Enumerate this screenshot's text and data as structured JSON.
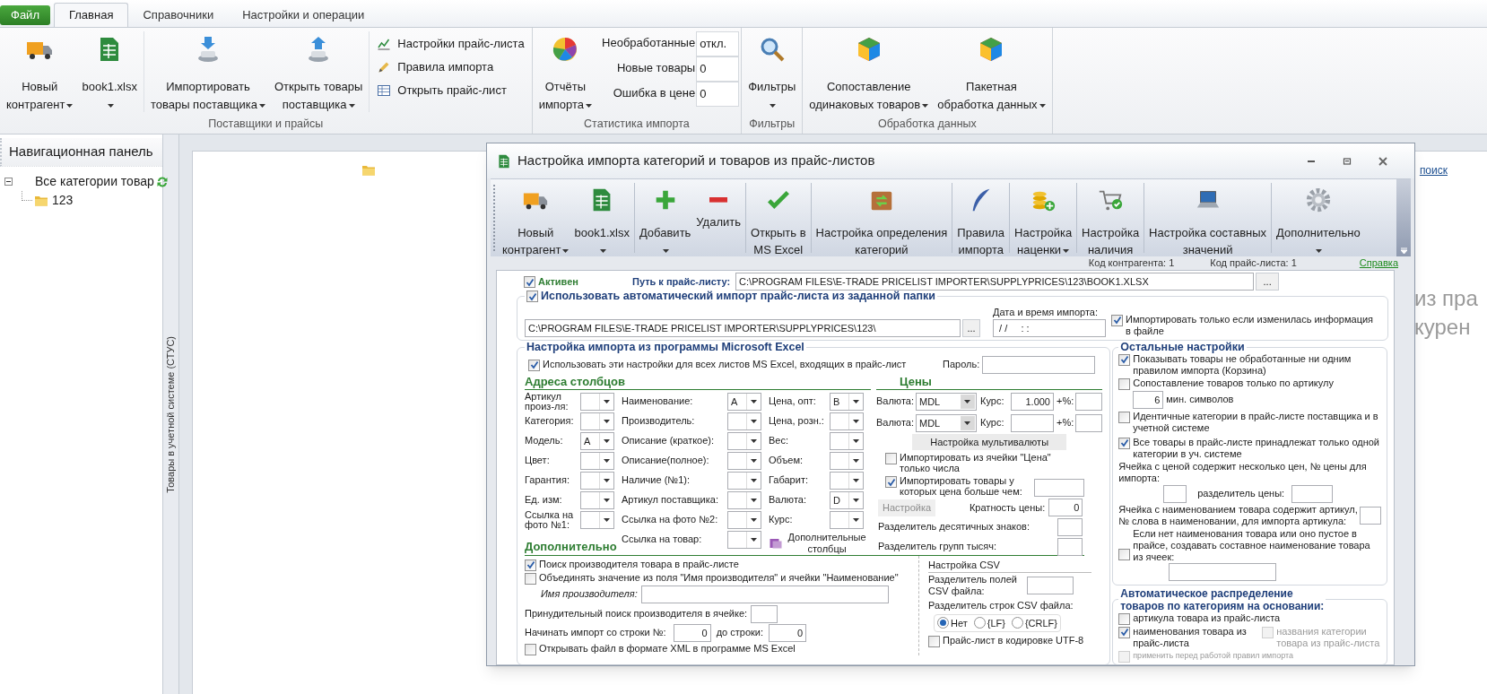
{
  "ribbon": {
    "tabs": [
      {
        "label": "Файл",
        "kind": "file",
        "selected": false
      },
      {
        "label": "Главная",
        "kind": "tab",
        "selected": true
      },
      {
        "label": "Справочники",
        "kind": "tab",
        "selected": false
      },
      {
        "label": "Настройки и операции",
        "kind": "tab",
        "selected": false
      }
    ],
    "groups": [
      {
        "label": "Поставщики и прайсы",
        "items": [
          {
            "kind": "large",
            "label": "Новый\nконтрагент",
            "dropdown": true
          },
          {
            "kind": "large",
            "label": "book1.xlsx",
            "dropdown": true
          },
          {
            "kind": "separator"
          },
          {
            "kind": "large",
            "label": "Импортировать\nтовары поставщика",
            "dropdown": true
          },
          {
            "kind": "large",
            "label": "Открыть товары\nпоставщика",
            "dropdown": true
          },
          {
            "kind": "separator"
          },
          {
            "kind": "small",
            "entries": [
              "Настройки прайс-листа",
              "Правила импорта",
              "Открыть прайс-лист"
            ]
          }
        ]
      },
      {
        "label": "Статистика импорта",
        "items": [
          {
            "kind": "large",
            "label": "Отчёты\nимпорта",
            "dropdown": true
          },
          {
            "kind": "stats",
            "entries": [
              {
                "label": "Необработанные",
                "value": "откл."
              },
              {
                "label": "Новые товары",
                "value": "0"
              },
              {
                "label": "Ошибка в цене",
                "value": "0"
              }
            ]
          }
        ]
      },
      {
        "label": "Фильтры",
        "items": [
          {
            "kind": "large",
            "label": "Фильтры",
            "dropdown": true
          }
        ]
      },
      {
        "label": "Обработка данных",
        "items": [
          {
            "kind": "large",
            "label": "Сопоставление\nодинаковых товаров",
            "dropdown": true
          },
          {
            "kind": "large",
            "label": "Пакетная\nобработка данных",
            "dropdown": true
          }
        ]
      }
    ]
  },
  "navigation": {
    "title": "Навигационная панель",
    "tree": [
      {
        "label": "Все категории товар",
        "expanded": true,
        "children": [
          {
            "label": "123"
          }
        ]
      }
    ]
  },
  "side_tab": "Товары в учетной системе (СТУС)",
  "background": {
    "link": "поиск",
    "text_lines": [
      "из пра",
      "курен"
    ]
  },
  "dialog": {
    "title": "Настройка импорта категорий и товаров из прайс-листов",
    "toolbar": [
      {
        "kind": "button",
        "label": "Новый\nконтрагент",
        "dropdown": true
      },
      {
        "kind": "button",
        "label": "book1.xlsx",
        "dropdown": true
      },
      {
        "kind": "separator"
      },
      {
        "kind": "button",
        "label": "Добавить",
        "dropdown": true
      },
      {
        "kind": "button",
        "label": "Удалить",
        "dropdown": false
      },
      {
        "kind": "separator"
      },
      {
        "kind": "button",
        "label": "Открыть в\nMS Excel",
        "dropdown": false
      },
      {
        "kind": "separator"
      },
      {
        "kind": "button",
        "label": "Настройка определения\nкатегорий",
        "dropdown": false
      },
      {
        "kind": "separator"
      },
      {
        "kind": "button",
        "label": "Правила\nимпорта",
        "dropdown": false
      },
      {
        "kind": "separator"
      },
      {
        "kind": "button",
        "label": "Настройка\nнаценки",
        "dropdown": true
      },
      {
        "kind": "separator"
      },
      {
        "kind": "button",
        "label": "Настройка\nналичия",
        "dropdown": false
      },
      {
        "kind": "separator"
      },
      {
        "kind": "button",
        "label": "Настройка составных\nзначений",
        "dropdown": false
      },
      {
        "kind": "separator"
      },
      {
        "kind": "button",
        "label": "Дополнительно",
        "dropdown": true
      }
    ],
    "info": {
      "contractor_code": "Код контрагента: 1",
      "pricelist_code": "Код прайс-листа: 1",
      "help_link": "Справка"
    },
    "form": {
      "active": {
        "label": "Активен",
        "checked": true
      },
      "path_label": "Путь к прайс-листу:",
      "path": "C:\\PROGRAM FILES\\E-TRADE PRICELIST IMPORTER\\SUPPLYPRICES\\123\\BOOK1.XLSX",
      "path_browse": "...",
      "auto_import": {
        "label": "Использовать автоматический импорт прайс-листа из заданной папки",
        "checked": true,
        "folder": "C:\\PROGRAM FILES\\E-TRADE PRICELIST IMPORTER\\SUPPLYPRICES\\123\\",
        "browse": "...",
        "date_label": "Дата и время импорта:",
        "date_value": " / /     : :",
        "only_if_changed": {
          "label": "Импортировать только если изменилась информация в файле",
          "checked": true
        }
      },
      "excel": {
        "title": "Настройка импорта из программы Microsoft Excel",
        "all_sheets": {
          "label": "Использовать эти настройки для всех листов MS Excel, входящих в прайс-лист",
          "checked": true
        },
        "password_label": "Пароль:",
        "addresses_title": "Адреса столбцов",
        "address_columns": [
          [
            {
              "label": "Артикул произ-ля:"
            },
            {
              "label": "Категория:"
            },
            {
              "label": "Модель:",
              "value": "A"
            },
            {
              "label": "Цвет:"
            },
            {
              "label": "Гарантия:"
            },
            {
              "label": "Ед. изм:"
            },
            {
              "label": "Ссылка на фото №1:"
            }
          ],
          [
            {
              "label": "Наименование:",
              "value": "A"
            },
            {
              "label": "Производитель:"
            },
            {
              "label": "Описание (краткое):"
            },
            {
              "label": "Описание(полное):"
            },
            {
              "label": "Наличие (№1):"
            },
            {
              "label": "Артикул поставщика:"
            },
            {
              "label": "Ссылка на фото №2:"
            },
            {
              "label": "Ссылка на товар:"
            }
          ],
          [
            {
              "label": "Цена, опт:",
              "value": "B"
            },
            {
              "label": "Цена, розн.:"
            },
            {
              "label": "Вес:"
            },
            {
              "label": "Объем:"
            },
            {
              "label": "Габарит:"
            },
            {
              "label": "Валюта:",
              "value": "D"
            },
            {
              "label": "Курс:"
            }
          ]
        ],
        "extra_columns_button": "Дополнительные столбцы",
        "prices_title": "Цены",
        "currencies": [
          {
            "label": "Валюта:",
            "value": "MDL",
            "rate_label": "Курс:",
            "rate": "1.000",
            "markup_label": "+%:"
          },
          {
            "label": "Валюта:",
            "value": "MDL",
            "rate_label": "Курс:",
            "markup_label": "+%:"
          }
        ],
        "multicurrency_button": "Настройка мультивалюты",
        "numbers_only": {
          "label": "Импортировать из ячейки \"Цена\" только числа",
          "checked": false
        },
        "price_greater": {
          "label": "Импортировать товары у которых цена больше чем:",
          "checked": true
        },
        "setup_button": {
          "label": "Настройка",
          "disabled": true
        },
        "price_multiple_label": "Кратность цены:",
        "price_multiple": "0",
        "decimal_sep_label": "Разделитель десятичных знаков:",
        "thousand_sep_label": "Разделитель групп тысяч:",
        "extra": {
          "title": "Дополнительно",
          "search_maker": {
            "label": "Поиск производителя товара в прайс-листе",
            "checked": true
          },
          "merge_name": {
            "label": "Объединять значение из поля \"Имя производителя\" и ячейки \"Наименование\"",
            "checked": false
          },
          "maker_name_label": "Имя производителя:",
          "forced_search_label": "Принудительный поиск производителя в ячейке:",
          "start_row_label": "Начинать импорт со строки №:",
          "start_row": "0",
          "end_row_label": "до строки:",
          "end_row": "0",
          "open_xml": {
            "label": "Открывать файл в формате XML в программе MS Excel",
            "checked": false
          }
        },
        "csv": {
          "title": "Настройка CSV",
          "field_sep_label": "Разделитель полей CSV файла:",
          "row_sep_label": "Разделитель строк CSV файла:",
          "row_separators": [
            {
              "label": "Нет",
              "selected": true
            },
            {
              "label": "{LF}",
              "selected": false
            },
            {
              "label": "{CRLF}",
              "selected": false
            }
          ],
          "utf8": {
            "label": "Прайс-лист в кодировке UTF-8",
            "checked": false
          }
        }
      },
      "other": {
        "title": "Остальные настройки",
        "show_unprocessed": {
          "label": "Показывать товары не обработанные ни одним правилом импорта (Корзина)",
          "checked": true
        },
        "match_by_sku": {
          "label": "Сопоставление товаров только по артикулу",
          "checked": false
        },
        "min_chars": "6",
        "min_chars_label": "мин. символов",
        "identical_categories": {
          "label": "Идентичные категории в прайс-листе поставщика и в учетной системе",
          "checked": false
        },
        "single_category": {
          "label": "Все товары в прайс-листе принадлежат только одной категории в уч. системе",
          "checked": true
        },
        "multi_price_label": "Ячейка с ценой содержит несколько цен, № цены для импорта:",
        "price_sep_label": "разделитель цены:",
        "sku_in_name_label": "Ячейка с наименованием товара содержит артикул, № слова в наименовании, для импорта артикула:",
        "compose_name": {
          "label": "Если нет наименования товара или оно пустое в прайсе, создавать составное наименование товара из ячеек:",
          "checked": false
        }
      },
      "auto_distribution": {
        "title": "Автоматическое распределение\nтоваров по категориям на основании:",
        "options": [
          {
            "label": "артикула товара из прайс-листа",
            "checked": false,
            "disabled": false
          },
          {
            "label": "наименования товара из прайс-листа",
            "checked": true,
            "disabled": false
          },
          {
            "label": "названия  категории товара из прайс-листа",
            "checked": false,
            "disabled": true
          },
          {
            "label": "применить перед работой правил импорта",
            "checked": false,
            "disabled": true
          }
        ]
      }
    }
  }
}
